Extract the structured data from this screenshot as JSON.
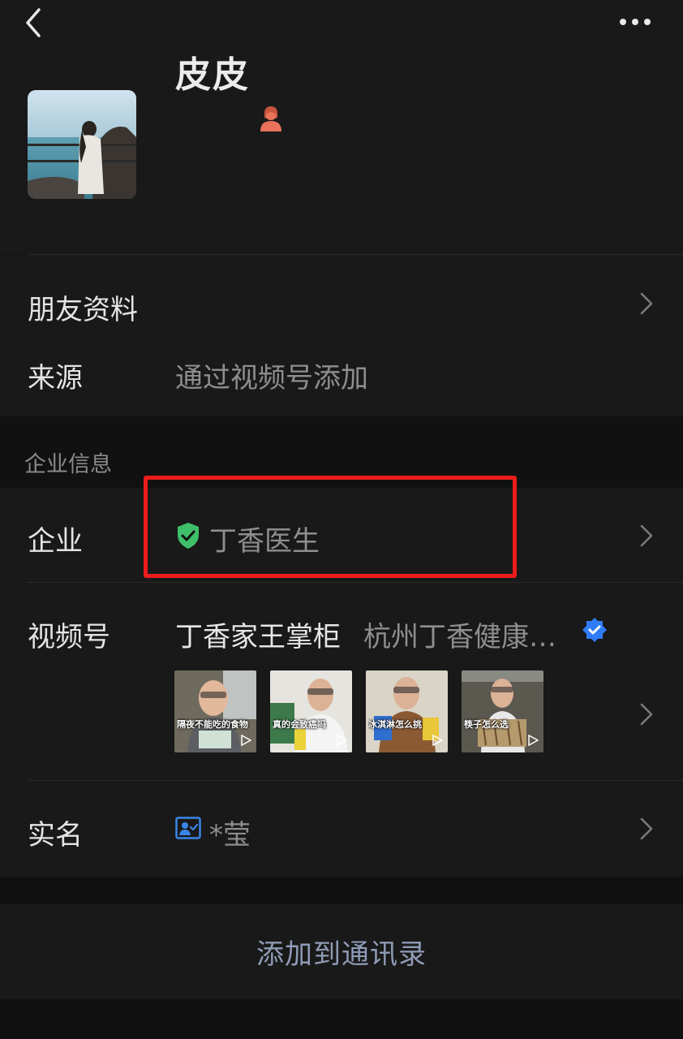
{
  "profile": {
    "nickname": "皮皮"
  },
  "info": {
    "friend_profile_label": "朋友资料",
    "source_label": "来源",
    "source_value": "通过视频号添加"
  },
  "enterprise": {
    "section_title": "企业信息",
    "company_label": "企业",
    "company_value": "丁香医生",
    "channel_label": "视频号",
    "channel_name": "丁香家王掌柜",
    "channel_org": "杭州丁香健康…",
    "videos": [
      {
        "caption": "隔夜不能吃的食物"
      },
      {
        "caption": "真的会致癌吗"
      },
      {
        "caption": "冰淇淋怎么挑"
      },
      {
        "caption": "筷子怎么选"
      }
    ],
    "realname_label": "实名",
    "realname_value": "*莹"
  },
  "actions": {
    "add_contact": "添加到通讯录"
  },
  "colors": {
    "highlight_border": "#ec1c1c",
    "verified_green": "#3fbf6a",
    "verified_blue": "#2f7cf6",
    "gender_female": "#e8735a"
  }
}
